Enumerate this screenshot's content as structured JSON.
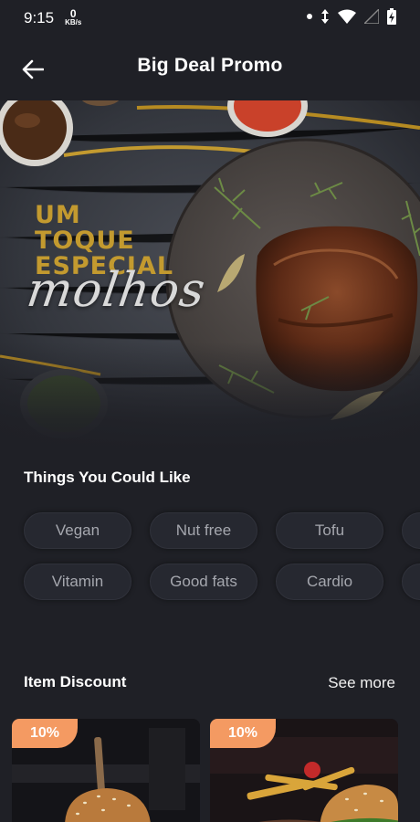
{
  "status_bar": {
    "time": "9:15",
    "speed_value": "0",
    "speed_unit": "KB/s",
    "icons": [
      "notification-dot-icon",
      "data-arrows-icon",
      "wifi-icon",
      "signal-icon",
      "battery-charging-icon"
    ]
  },
  "app_bar": {
    "title": "Big Deal Promo",
    "back_icon": "arrow-left-icon"
  },
  "banner": {
    "line1": "UM",
    "line2": "TOQUE",
    "line3": "ESPECIAL",
    "script": "molhos"
  },
  "things_section": {
    "title": "Things You Could Like",
    "row1": [
      "Vegan",
      "Nut free",
      "Tofu"
    ],
    "row2": [
      "Vitamin",
      "Good fats",
      "Cardio"
    ]
  },
  "discount_section": {
    "title": "Item Discount",
    "see_more": "See more",
    "items": [
      {
        "badge": "10%"
      },
      {
        "badge": "10%"
      }
    ]
  },
  "colors": {
    "background": "#1f2026",
    "chip_text": "#a5a7ae",
    "badge": "#f49a62",
    "banner_yellow": "#c39a2f"
  }
}
